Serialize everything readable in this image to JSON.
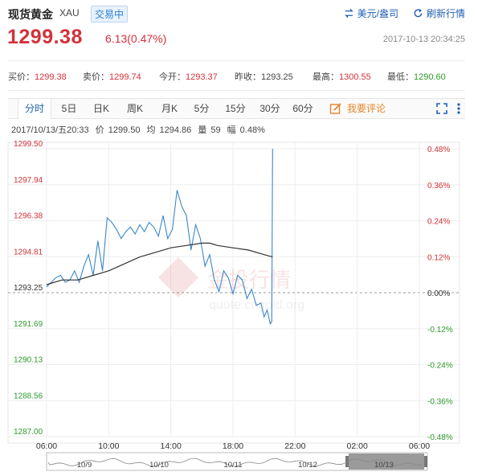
{
  "header": {
    "title": "现货黄金",
    "symbol": "XAU",
    "status": "交易中",
    "currency_link": "美元/盎司",
    "refresh_link": "刷新行情"
  },
  "quote": {
    "price": "1299.38",
    "change": "6.13(0.47%)",
    "timestamp": "2017-10-13 20:34:25"
  },
  "stats": [
    {
      "label": "买价：",
      "value": "1299.38",
      "color": "up"
    },
    {
      "label": "卖价：",
      "value": "1299.74",
      "color": "up"
    },
    {
      "label": "今开：",
      "value": "1293.37",
      "color": "up"
    },
    {
      "label": "昨收：",
      "value": "1293.25",
      "color": "neutral"
    },
    {
      "label": "最高：",
      "value": "1300.55",
      "color": "up"
    },
    {
      "label": "最低：",
      "value": "1290.60",
      "color": "down"
    }
  ],
  "tabs": [
    "分时",
    "5日",
    "日K",
    "周K",
    "月K",
    "5分",
    "15分",
    "30分",
    "60分"
  ],
  "active_tab": "分时",
  "comment_label": "我要评论",
  "info_bar": {
    "datetime": "2017/10/13/五20:33",
    "price_label": "价",
    "price": "1299.50",
    "avg_label": "均",
    "avg": "1294.86",
    "vol_label": "量",
    "vol": "59",
    "amp_label": "幅",
    "amp": "0.48%"
  },
  "watermark": {
    "text": "金投行情",
    "url": "quote.cngold.org",
    "logo": "Au"
  },
  "colors": {
    "up": "#d1323a",
    "down": "#2e9a2e",
    "price_line": "#3b86c8",
    "avg_line": "#333333",
    "link": "#1e5fb4",
    "comment": "#e6852b"
  },
  "chart_data": {
    "type": "line",
    "title": "",
    "y_labels_left": [
      "1299.50",
      "1297.94",
      "1296.38",
      "1294.81",
      "1293.25",
      "1291.69",
      "1290.13",
      "1288.56",
      "1287.00"
    ],
    "y_labels_right": [
      "0.48%",
      "0.36%",
      "0.24%",
      "0.12%",
      "0.00%",
      "-0.12%",
      "-0.24%",
      "-0.36%",
      "-0.48%"
    ],
    "ylim": [
      1287.0,
      1299.5
    ],
    "prev_close": 1293.25,
    "x_ticks": [
      "06:00",
      "10:00",
      "14:00",
      "18:00",
      "22:00",
      "02:00",
      "06:00"
    ],
    "x_hours": [
      6,
      10,
      14,
      18,
      22,
      26,
      30
    ],
    "xlim_hours": [
      6,
      30
    ],
    "grid": true,
    "series": [
      {
        "x_hours": [
          6.0,
          6.3,
          6.6,
          6.9,
          7.2,
          7.5,
          7.8,
          8.1,
          8.4,
          8.7,
          9.0,
          9.3,
          9.6,
          9.9,
          10.2,
          10.5,
          10.8,
          11.1,
          11.4,
          11.7,
          12.0,
          12.3,
          12.6,
          12.9,
          13.2,
          13.5,
          13.8,
          14.1,
          14.4,
          14.7,
          15.0,
          15.3,
          15.6,
          15.9,
          16.2,
          16.5,
          16.8,
          17.1,
          17.4,
          17.7,
          18.0,
          18.3,
          18.6,
          18.9,
          19.2,
          19.5,
          19.8,
          20.0,
          20.2,
          20.4,
          20.5,
          20.55
        ],
        "values": [
          1293.5,
          1293.7,
          1293.9,
          1294.0,
          1293.7,
          1293.8,
          1294.2,
          1293.7,
          1294.4,
          1294.9,
          1294.0,
          1295.5,
          1294.2,
          1296.5,
          1296.3,
          1296.0,
          1295.6,
          1295.9,
          1296.1,
          1295.8,
          1296.2,
          1295.9,
          1296.3,
          1296.1,
          1295.7,
          1296.6,
          1295.6,
          1296.0,
          1297.7,
          1297.0,
          1296.6,
          1295.1,
          1296.2,
          1295.6,
          1294.4,
          1294.9,
          1293.8,
          1293.3,
          1294.2,
          1293.9,
          1293.2,
          1294.0,
          1293.8,
          1293.0,
          1293.4,
          1292.7,
          1292.8,
          1292.2,
          1292.5,
          1291.9,
          1292.0,
          1299.5
        ]
      },
      {
        "x_hours": [
          6.0,
          7.0,
          8.0,
          9.0,
          10.0,
          11.0,
          12.0,
          13.0,
          14.0,
          15.0,
          16.0,
          16.5,
          17.0,
          18.0,
          19.0,
          20.0,
          20.55
        ],
        "values": [
          1293.6,
          1293.8,
          1293.8,
          1294.0,
          1294.2,
          1294.5,
          1294.8,
          1295.0,
          1295.2,
          1295.3,
          1295.4,
          1295.4,
          1295.3,
          1295.2,
          1295.1,
          1294.9,
          1294.8
        ]
      }
    ],
    "navigator_labels": [
      "10/9",
      "10/10",
      "10/11",
      "10/12",
      "10/13"
    ]
  }
}
